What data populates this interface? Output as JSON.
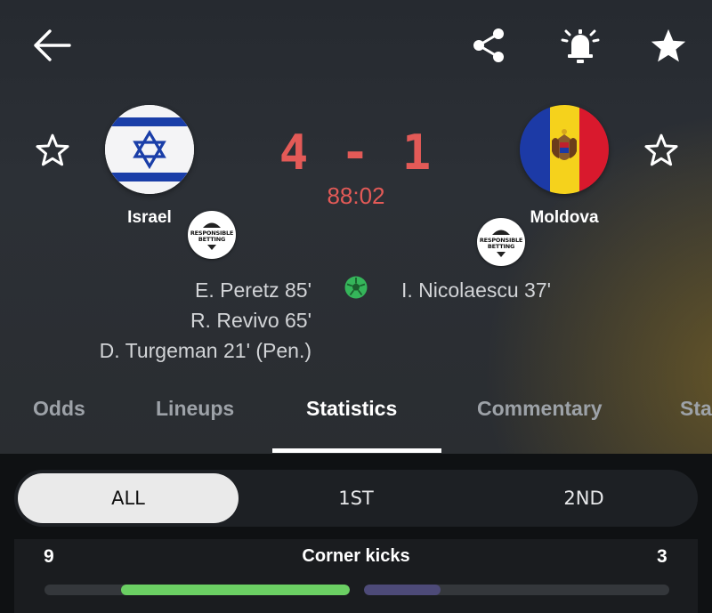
{
  "header": {
    "back_icon": "arrow-left-icon",
    "share_icon": "share-icon",
    "alarm_icon": "alarm-bell-icon",
    "favorite_icon": "star-filled-icon"
  },
  "match": {
    "home": {
      "name": "Israel",
      "flag": "israel-flag",
      "favorite_icon": "star-outline-icon"
    },
    "away": {
      "name": "Moldova",
      "flag": "moldova-flag",
      "favorite_icon": "star-outline-icon"
    },
    "score": "4 - 1",
    "clock": "88:02",
    "responsible_betting": "RESPONSIBLE BETTING",
    "home_scorers": [
      "E. Peretz 85'",
      "R. Revivo 65'",
      "D. Turgeman 21' (Pen.)"
    ],
    "away_scorers": [
      "I. Nicolaescu 37'"
    ],
    "goal_icon": "soccer-ball-icon"
  },
  "tabs": [
    {
      "label": "Odds",
      "active": false
    },
    {
      "label": "Lineups",
      "active": false
    },
    {
      "label": "Statistics",
      "active": true
    },
    {
      "label": "Commentary",
      "active": false
    },
    {
      "label": "Sta",
      "active": false
    }
  ],
  "periods": [
    {
      "label": "ALL",
      "active": true
    },
    {
      "label": "1ST",
      "active": false
    },
    {
      "label": "2ND",
      "active": false
    }
  ],
  "stats": [
    {
      "label": "Corner kicks",
      "home": "9",
      "away": "3",
      "home_fraction": 0.75,
      "away_fraction": 0.25
    }
  ],
  "colors": {
    "score": "#e35a57",
    "home_bar": "#6bcf63",
    "away_bar": "#4d4a78",
    "goal_icon": "#35b55a"
  }
}
